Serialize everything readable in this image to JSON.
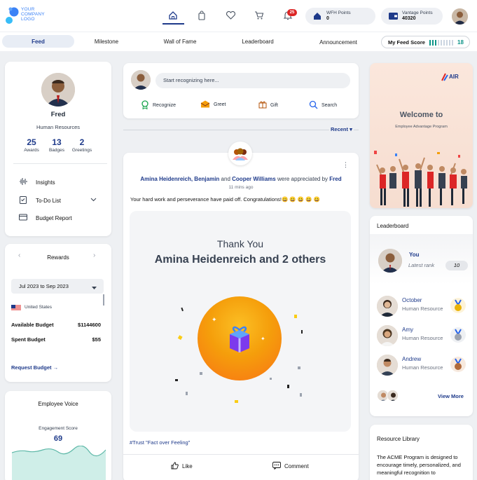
{
  "header": {
    "logo_line1": "YOUR",
    "logo_line2": "COMPANY",
    "logo_line3": "LOGO",
    "notification_count": "25",
    "wfh_label": "WFH Points",
    "wfh_value": "0",
    "vantage_label": "Vantage Points",
    "vantage_value": "40320",
    "icons": [
      "home-icon",
      "shopping-bag-icon",
      "heart-icon",
      "cart-icon",
      "bell-icon"
    ]
  },
  "tabs": [
    {
      "label": "Feed"
    },
    {
      "label": "Milestone"
    },
    {
      "label": "Wall of Fame"
    },
    {
      "label": "Leaderboard"
    },
    {
      "label": "Announcement"
    }
  ],
  "feed_score": {
    "label": "My Feed Score",
    "value": "18",
    "fraction": 0.35
  },
  "profile": {
    "name": "Fred",
    "department": "Human Resources",
    "stats": [
      {
        "value": "25",
        "label": "Awards"
      },
      {
        "value": "13",
        "label": "Badges"
      },
      {
        "value": "2",
        "label": "Greetings"
      }
    ],
    "menu": [
      {
        "label": "Insights"
      },
      {
        "label": "To-Do List"
      },
      {
        "label": "Budget Report"
      }
    ]
  },
  "rewards": {
    "title": "Rewards",
    "period": "Jul 2023 to Sep 2023",
    "country": "United States",
    "available_label": "Available Budget",
    "available_value": "$1144600",
    "spent_label": "Spent Budget",
    "spent_value": "$55",
    "request_link": "Request Budget →"
  },
  "employee_voice": {
    "title": "Employee Voice",
    "score_label": "Engagement Score",
    "score_value": "69"
  },
  "composer": {
    "placeholder": "Start recognizing here...",
    "actions": [
      {
        "label": "Recognize"
      },
      {
        "label": "Greet"
      },
      {
        "label": "Gift"
      },
      {
        "label": "Search"
      }
    ],
    "sort_label": "Recent"
  },
  "post": {
    "author1": "Amina Heidenreich, Benjamin",
    "and_text": "and",
    "author2": "Cooper Williams",
    "verb": "were appreciated by",
    "by": "Fred",
    "time": "11 mins ago",
    "message": "Your hard work and perseverance have paid off. Congratulations!😀 😀 😀 😀 😀",
    "card_title": "Thank You",
    "card_names": "Amina Heidenreich and 2 others",
    "hashtag": "#Trust \"Fact over Feeling\"",
    "like_label": "Like",
    "comment_label": "Comment"
  },
  "welcome": {
    "brand": "AIR",
    "title": "Welcome to",
    "subtitle": "Employee  Advantage  Program"
  },
  "leaderboard": {
    "title": "Leaderboard",
    "you_label": "You",
    "you_rank_label": "Latest rank",
    "you_rank": "10",
    "rows": [
      {
        "name": "October",
        "dept": "Human Resource",
        "medal": "gold"
      },
      {
        "name": "Amy",
        "dept": "Human Resource",
        "medal": "silver"
      },
      {
        "name": "Andrew",
        "dept": "Human Resource",
        "medal": "bronze"
      }
    ],
    "view_more": "View More"
  },
  "resource_library": {
    "title": "Resource Library",
    "text": "The ACME Program is designed to encourage timely, personalized, and meaningful recognition to"
  },
  "colors": {
    "accent": "#1e3a8a",
    "score_green": "#0d9488",
    "badge_red": "#dc2626",
    "gift_orange": "#f28b2a"
  }
}
